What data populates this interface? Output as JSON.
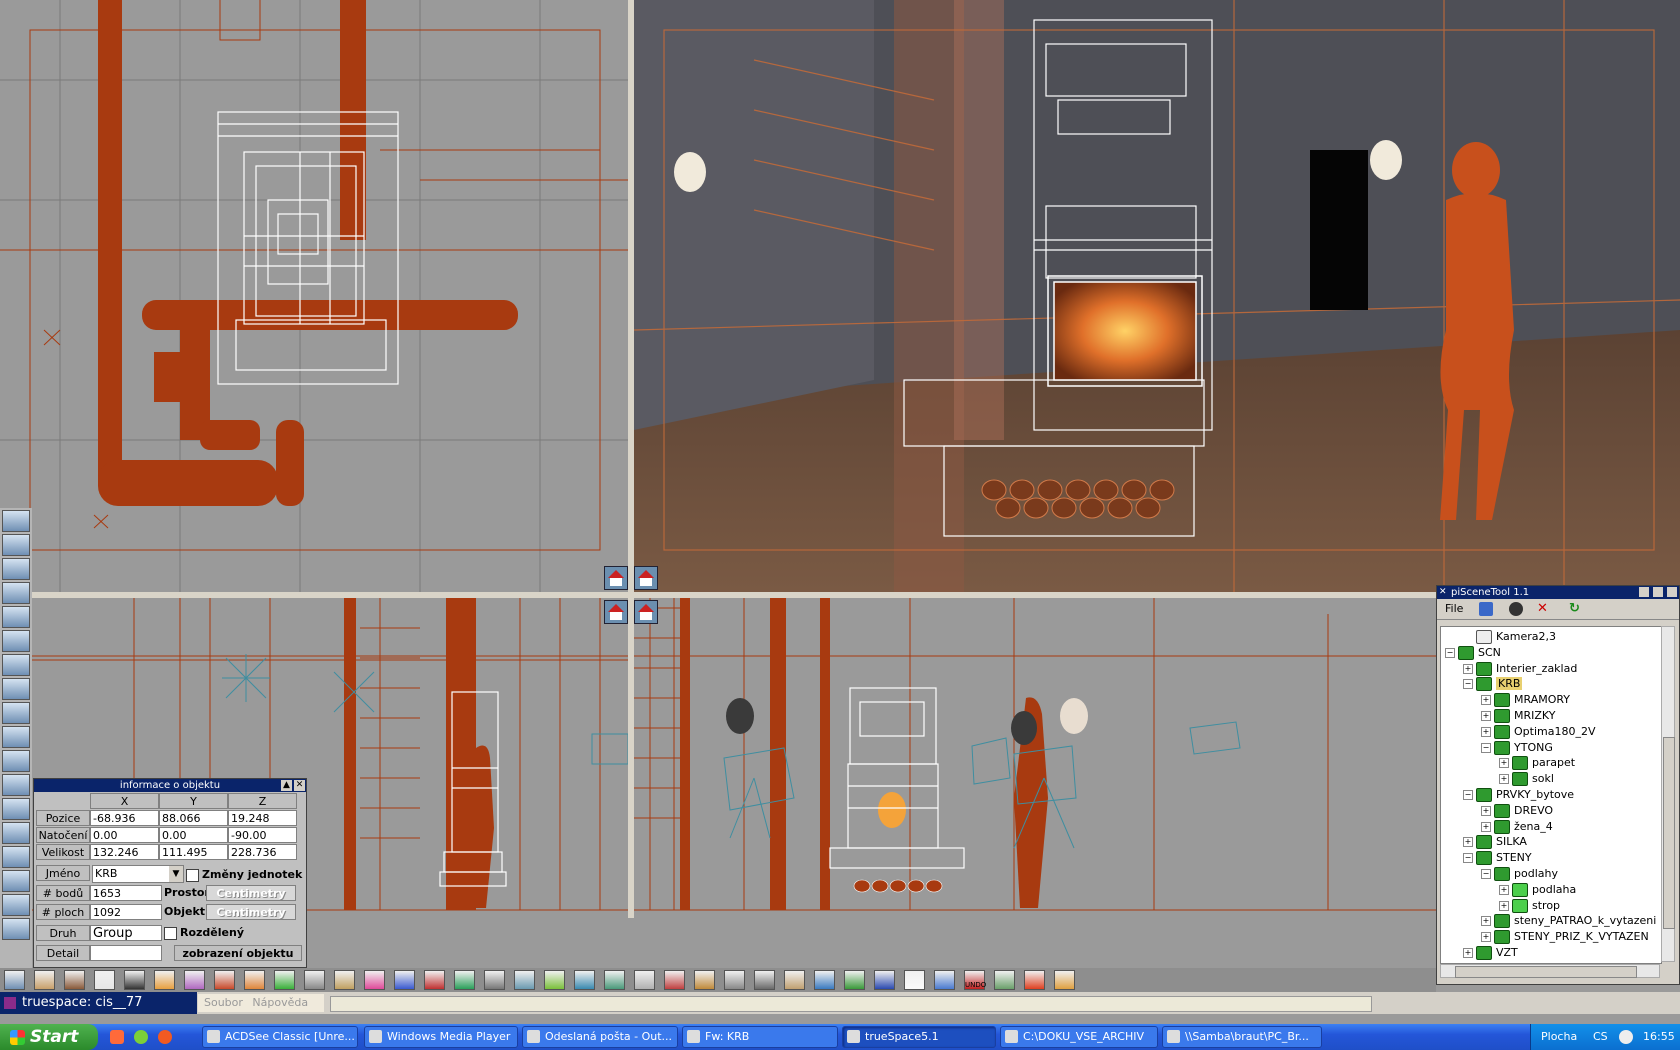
{
  "app": {
    "window_title": "truespace: cis__77",
    "menu": [
      "Soubor",
      "Nápověda"
    ]
  },
  "colors": {
    "wire_orange": "#a83a10",
    "wire_white": "#ffffff",
    "camera_teal": "#3f8ea0",
    "titlebar_blue": "#0a246a"
  },
  "object_info": {
    "title": "informace o objektu",
    "col_headers": [
      "X",
      "Y",
      "Z"
    ],
    "rows": [
      {
        "label": "Pozice",
        "x": "-68.936",
        "y": "88.066",
        "z": "19.248"
      },
      {
        "label": "Natočení",
        "x": "0.00",
        "y": "0.00",
        "z": "-90.00"
      },
      {
        "label": "Velikost",
        "x": "132.246",
        "y": "111.495",
        "z": "228.736"
      }
    ],
    "name_label": "Jméno",
    "name_value": "KRB",
    "units_change_label": "Změny jednotek",
    "points_label": "# bodů",
    "points_value": "1653",
    "faces_label": "# ploch",
    "faces_value": "1092",
    "space_label": "Prostor",
    "space_value": "Centimetry",
    "object_label": "Objekt",
    "object_value": "Centimetry",
    "kind_label": "Druh",
    "kind_value": "Group",
    "split_label": "Rozdělený",
    "detail_label": "Detail",
    "detail_value": "",
    "display_button": "zobrazení objektu"
  },
  "scene_tool": {
    "title": "piSceneTool 1.1",
    "menu_file": "File",
    "tree": [
      {
        "label": "Kamera2,3",
        "depth": 1,
        "icon": "camera-icon",
        "expander": ""
      },
      {
        "label": "SCN",
        "depth": 0,
        "icon": "group-icon",
        "expander": "−"
      },
      {
        "label": "Interier_zaklad",
        "depth": 1,
        "icon": "group-icon",
        "expander": "+"
      },
      {
        "label": "KRB",
        "depth": 1,
        "icon": "group-icon",
        "expander": "−",
        "selected": true
      },
      {
        "label": "MRAMORY",
        "depth": 2,
        "icon": "group-icon",
        "expander": "+"
      },
      {
        "label": "MRIZKY",
        "depth": 2,
        "icon": "group-icon",
        "expander": "+"
      },
      {
        "label": "Optima180_2V",
        "depth": 2,
        "icon": "group-icon",
        "expander": "+"
      },
      {
        "label": "YTONG",
        "depth": 2,
        "icon": "group-icon",
        "expander": "−"
      },
      {
        "label": "parapet",
        "depth": 3,
        "icon": "group-icon",
        "expander": "+"
      },
      {
        "label": "sokl",
        "depth": 3,
        "icon": "group-icon",
        "expander": "+"
      },
      {
        "label": "PRVKY_bytove",
        "depth": 1,
        "icon": "group-icon",
        "expander": "−"
      },
      {
        "label": "DREVO",
        "depth": 2,
        "icon": "group-icon",
        "expander": "+"
      },
      {
        "label": "žena_4",
        "depth": 2,
        "icon": "group-icon",
        "expander": "+"
      },
      {
        "label": "SILKA",
        "depth": 1,
        "icon": "group-icon",
        "expander": "+"
      },
      {
        "label": "STENY",
        "depth": 1,
        "icon": "group-icon",
        "expander": "−"
      },
      {
        "label": "podlahy",
        "depth": 2,
        "icon": "group-icon",
        "expander": "−"
      },
      {
        "label": "podlaha",
        "depth": 3,
        "icon": "object-icon",
        "expander": "+"
      },
      {
        "label": "strop",
        "depth": 3,
        "icon": "object-icon",
        "expander": "+"
      },
      {
        "label": "steny_PATRAO_k_vytazeni",
        "depth": 2,
        "icon": "group-icon",
        "expander": "+"
      },
      {
        "label": "STENY_PRIZ_K_VYTAZEN",
        "depth": 2,
        "icon": "group-icon",
        "expander": "+"
      },
      {
        "label": "VZT",
        "depth": 1,
        "icon": "group-icon",
        "expander": "+"
      }
    ]
  },
  "toolbar_undo_label": "UNDO",
  "taskbar": {
    "start": "Start",
    "tasks": [
      {
        "label": "ACDSee Classic [Unre...",
        "active": false
      },
      {
        "label": "Windows Media Player",
        "active": false
      },
      {
        "label": "Odeslaná pošta - Out...",
        "active": false
      },
      {
        "label": "Fw: KRB",
        "active": false
      },
      {
        "label": "trueSpace5.1",
        "active": true
      },
      {
        "label": "C:\\DOKU_VSE_ARCHIV",
        "active": false
      },
      {
        "label": "\\\\Samba\\braut\\PC_Br...",
        "active": false
      }
    ],
    "tray_desktop": "Plocha",
    "tray_lang": "CS",
    "clock": "16:55"
  }
}
